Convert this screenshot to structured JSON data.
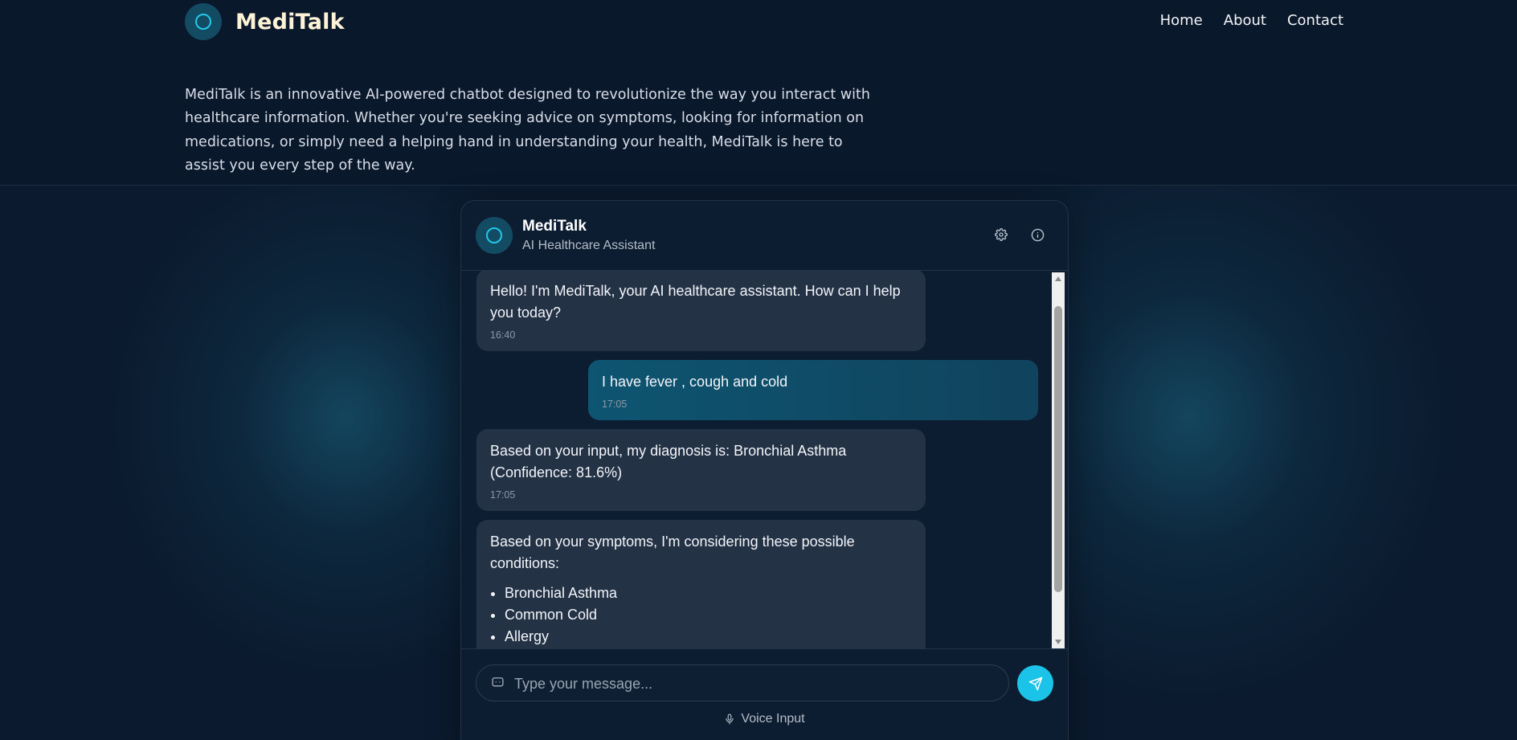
{
  "app": {
    "brand_name": "MediTalk",
    "accent_color": "#1cc3e8",
    "background_color": "#0b1a2e"
  },
  "nav": {
    "items": [
      {
        "label": "Home"
      },
      {
        "label": "About"
      },
      {
        "label": "Contact"
      }
    ]
  },
  "intro": {
    "text": "MediTalk is an innovative AI-powered chatbot designed to revolutionize the way you interact with healthcare information. Whether you're seeking advice on symptoms, looking for information on medications, or simply need a helping hand in understanding your health, MediTalk is here to assist you every step of the way."
  },
  "chat": {
    "title": "MediTalk",
    "subtitle": "AI Healthcare Assistant",
    "header_icons": [
      "gear-icon",
      "info-icon"
    ],
    "messages": [
      {
        "role": "bot",
        "text": "Hello! I'm MediTalk, your AI healthcare assistant. How can I help you today?",
        "time": "16:40"
      },
      {
        "role": "user",
        "text": "I have fever , cough and cold",
        "time": "17:05"
      },
      {
        "role": "bot",
        "text": "Based on your input, my diagnosis is: Bronchial Asthma (Confidence: 81.6%)",
        "time": "17:05"
      },
      {
        "role": "bot",
        "text": "Based on your symptoms, I'm considering these possible conditions:",
        "list": [
          "Bronchial Asthma",
          "Common Cold",
          "Allergy"
        ]
      }
    ],
    "input": {
      "placeholder": "Type your message...",
      "value": ""
    },
    "voice_label": "Voice Input"
  }
}
